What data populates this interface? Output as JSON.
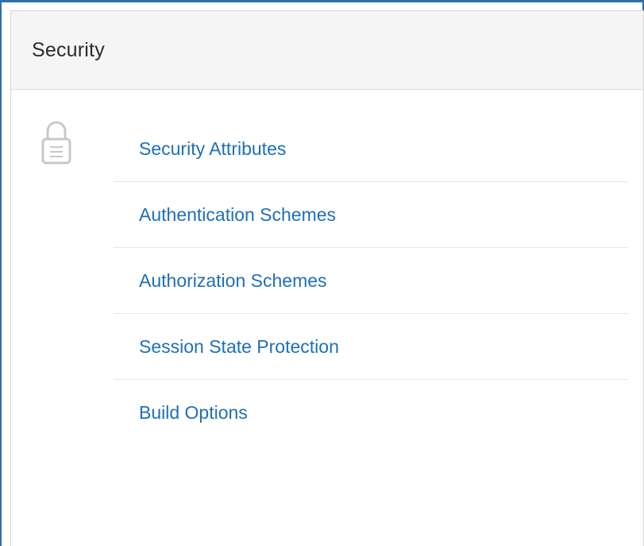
{
  "panel": {
    "title": "Security",
    "icon": "lock-icon",
    "links": [
      {
        "label": "Security Attributes"
      },
      {
        "label": "Authentication Schemes"
      },
      {
        "label": "Authorization Schemes"
      },
      {
        "label": "Session State Protection"
      },
      {
        "label": "Build Options"
      }
    ]
  },
  "colors": {
    "link": "#1f6fb8",
    "frame": "#2a6fb0",
    "header_bg": "#f5f5f5"
  }
}
